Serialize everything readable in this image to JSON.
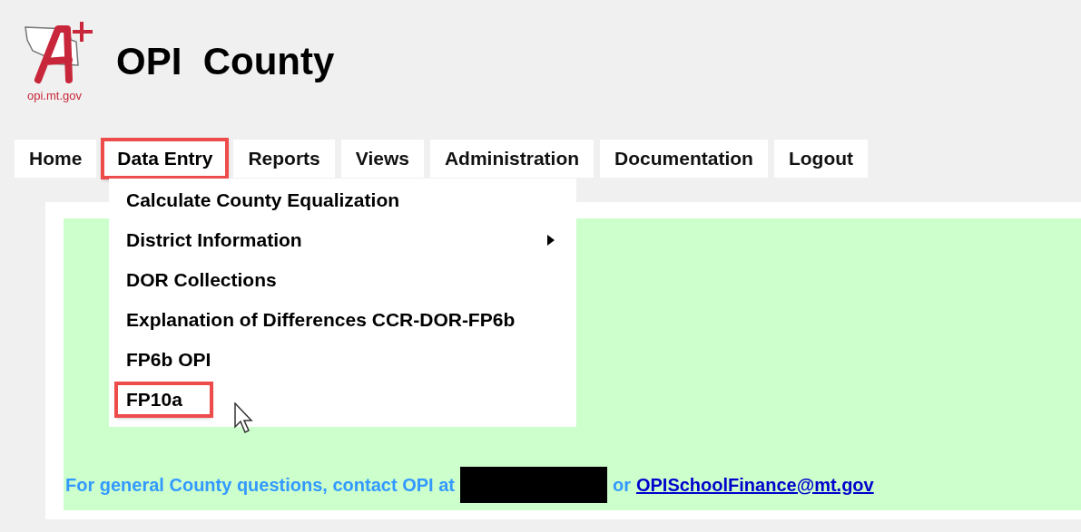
{
  "header": {
    "logo_text": "opi.mt.gov",
    "title": "OPI  County"
  },
  "nav": [
    {
      "label": "Home",
      "selected": false,
      "highlighted": false
    },
    {
      "label": "Data Entry",
      "selected": true,
      "highlighted": true
    },
    {
      "label": "Reports",
      "selected": false,
      "highlighted": false
    },
    {
      "label": "Views",
      "selected": false,
      "highlighted": false
    },
    {
      "label": "Administration",
      "selected": false,
      "highlighted": false
    },
    {
      "label": "Documentation",
      "selected": false,
      "highlighted": false
    },
    {
      "label": "Logout",
      "selected": false,
      "highlighted": false
    }
  ],
  "dropdown": [
    {
      "label": "Calculate County Equalization",
      "has_submenu": false,
      "highlighted": false
    },
    {
      "label": "District Information",
      "has_submenu": true,
      "highlighted": false
    },
    {
      "label": "DOR Collections",
      "has_submenu": false,
      "highlighted": false
    },
    {
      "label": "Explanation of Differences CCR-DOR-FP6b",
      "has_submenu": false,
      "highlighted": false
    },
    {
      "label": "FP6b OPI",
      "has_submenu": false,
      "highlighted": false
    },
    {
      "label": "FP10a",
      "has_submenu": false,
      "highlighted": true
    }
  ],
  "footer": {
    "text": "For general County questions, contact OPI at",
    "joiner": "or",
    "email": "OPISchoolFinance@mt.gov"
  }
}
